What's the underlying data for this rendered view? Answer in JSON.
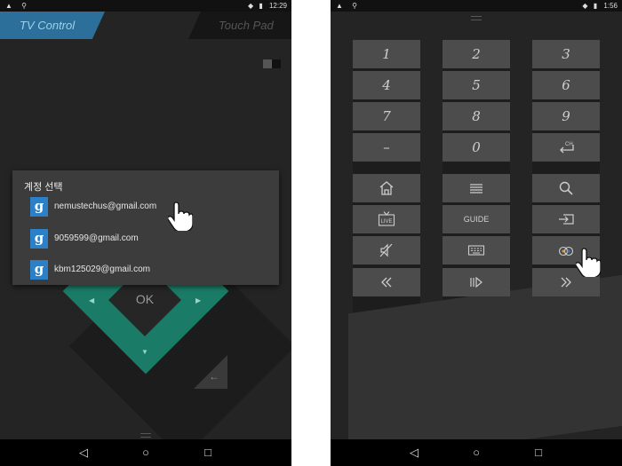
{
  "left_screen": {
    "status": {
      "time": "12:29",
      "left_icons": "▲ ⚲",
      "right_icons": "◆ ▮"
    },
    "tabs": [
      {
        "label": "TV Control",
        "active": true
      },
      {
        "label": "Touch Pad",
        "active": false
      }
    ],
    "dialog": {
      "title": "계정 선택",
      "accounts": [
        {
          "icon": "google-icon",
          "glyph": "g",
          "email": "nemustechus@gmail.com"
        },
        {
          "icon": "google-icon",
          "glyph": "g",
          "email": "9059599@gmail.com"
        },
        {
          "icon": "google-icon",
          "glyph": "g",
          "email": "kbm125029@gmail.com"
        }
      ]
    },
    "dpad": {
      "ok_label": "OK",
      "left": "◀",
      "right": "▶",
      "down": "▼",
      "back": "←"
    },
    "colors": {
      "accent_tab": "#2c6f9a",
      "dpad": "#1a7c66",
      "google": "#2c80c8"
    }
  },
  "right_screen": {
    "status": {
      "time": "1:56",
      "left_icons": "▲ ⚲",
      "right_icons": "◆ ▮"
    },
    "keypad": {
      "rows": [
        [
          "1",
          "2",
          "3"
        ],
        [
          "4",
          "5",
          "6"
        ],
        [
          "7",
          "8",
          "9"
        ],
        [
          "–",
          "0",
          "ch-return-icon"
        ]
      ]
    },
    "functions": [
      [
        "home-icon",
        "menu-icon",
        "search-icon"
      ],
      [
        "live-tv-icon",
        "GUIDE",
        "input-icon"
      ],
      [
        "mute-icon",
        "keyboard-icon",
        "voice-icon"
      ],
      [
        "rewind-icon",
        "play-pause-icon",
        "fast-forward-icon"
      ]
    ],
    "labels": {
      "guide": "GUIDE",
      "live": "LIVE",
      "ch": "CH"
    }
  },
  "nav": {
    "back": "◁",
    "home": "○",
    "recent": "□"
  }
}
